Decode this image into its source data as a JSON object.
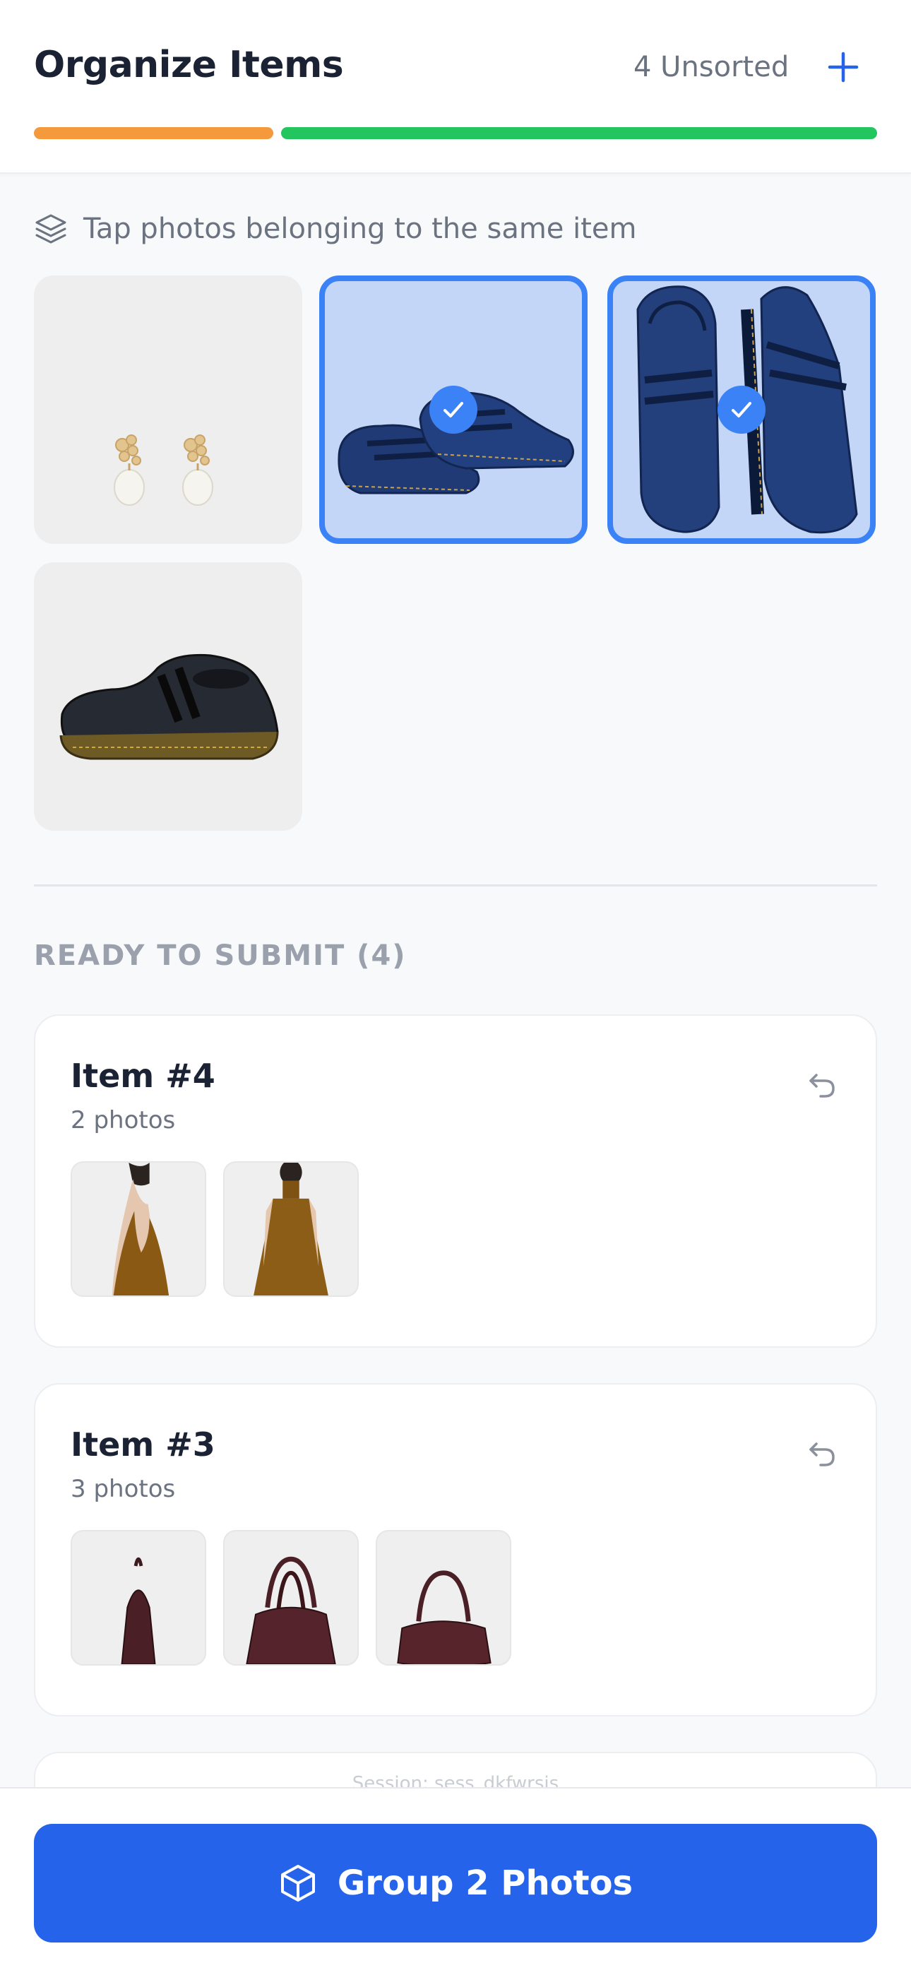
{
  "header": {
    "title": "Organize Items",
    "unsorted_label": "4 Unsorted",
    "add_icon": "plus-icon"
  },
  "progress": {
    "segments": [
      {
        "name": "unsorted",
        "color": "#f59a3c",
        "fraction": 0.284
      },
      {
        "name": "sorted",
        "color": "#22c55e",
        "fraction": 0.716
      }
    ]
  },
  "hint": {
    "icon": "layers-icon",
    "text": "Tap photos belonging to the same item"
  },
  "unsorted_photos": [
    {
      "subject": "pearl earrings",
      "selected": false
    },
    {
      "subject": "navy mary jane shoes pair side",
      "selected": true
    },
    {
      "subject": "navy mary jane shoes top view",
      "selected": true
    },
    {
      "subject": "black mary jane shoe",
      "selected": false
    }
  ],
  "ready": {
    "section_title": "READY TO SUBMIT (4)",
    "items": [
      {
        "title": "Item #4",
        "subtitle": "2 photos",
        "thumbs": [
          "brown halter top back",
          "brown halter top front"
        ]
      },
      {
        "title": "Item #3",
        "subtitle": "3 photos",
        "thumbs": [
          "burgundy handbag side",
          "burgundy handbag front",
          "burgundy handbag angle"
        ]
      }
    ],
    "session_text": "Session: sess_dkfwrsjs"
  },
  "footer": {
    "button_label": "Group 2 Photos",
    "button_icon": "box-icon"
  },
  "colors": {
    "accent": "#2563eb",
    "selected_border": "#3b82f6",
    "selected_fill": "#c3d6f8"
  }
}
